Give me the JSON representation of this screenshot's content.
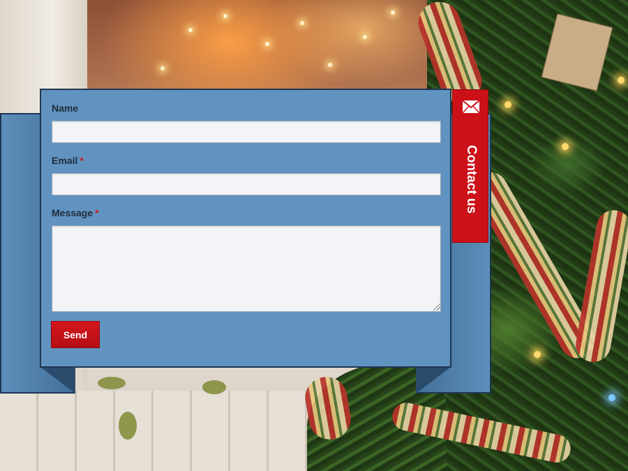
{
  "form": {
    "name_label": "Name",
    "email_label": "Email",
    "message_label": "Message",
    "required_marker": "*",
    "name_value": "",
    "email_value": "",
    "message_value": "",
    "send_label": "Send"
  },
  "tab": {
    "label": "Contact us",
    "icon": "envelope-icon"
  },
  "colors": {
    "ribbon_front": "#6093c0",
    "ribbon_back": "#416f99",
    "accent_red": "#cc1118",
    "required_red": "#d0181f"
  }
}
